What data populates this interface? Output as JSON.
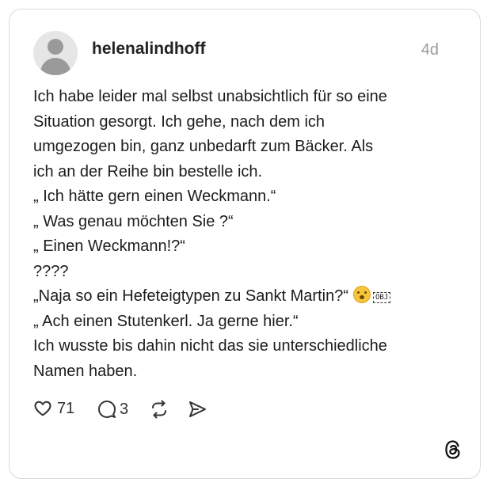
{
  "post": {
    "username": "helenalindhoff",
    "time": "4d",
    "lines": [
      "Ich habe leider mal selbst unabsichtlich für so eine",
      "Situation gesorgt. Ich gehe, nach dem ich",
      "umgezogen bin, ganz unbedarft zum Bäcker. Als",
      "ich an der Reihe bin bestelle ich.",
      "„ Ich hätte gern einen Weckmann.“",
      "„ Was genau möchten Sie ?“",
      "„ Einen Weckmann!?“",
      "????",
      "„Naja so ein Hefeteigtypen zu Sankt Martin?“",
      "„ Ach einen Stutenkerl. Ja gerne hier.“",
      "Ich wusste bis dahin nicht das sie unterschiedliche",
      "Namen haben."
    ],
    "obj_placeholder": "OBJ",
    "actions": {
      "likes": "71",
      "replies": "3"
    }
  },
  "icons": [
    "avatar-placeholder-icon",
    "heart-icon",
    "comment-icon",
    "repost-icon",
    "share-icon",
    "threads-logo-icon",
    "face-emoji-icon"
  ]
}
